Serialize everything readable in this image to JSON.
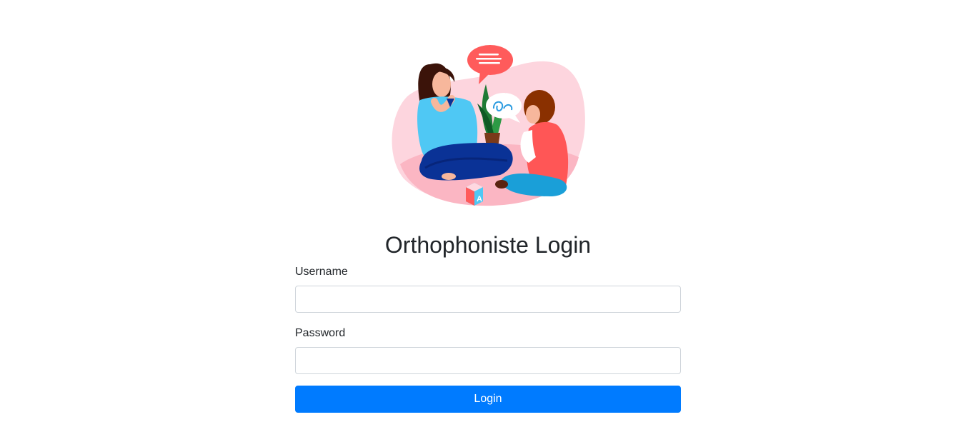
{
  "illustration": {
    "icon": "speech-therapy-illustration",
    "block_letter": "A"
  },
  "title": "Orthophoniste Login",
  "form": {
    "username_label": "Username",
    "username_value": "",
    "password_label": "Password",
    "password_value": "",
    "login_label": "Login"
  },
  "colors": {
    "accent": "#007bff",
    "blob": "#fdd5de",
    "blob_dark": "#fbb6c3",
    "bubble": "#ff5b5b",
    "woman_top": "#4fc8f4",
    "woman_pants": "#0a3296",
    "child_shirt": "#ff5656",
    "hair": "#3b1309"
  }
}
